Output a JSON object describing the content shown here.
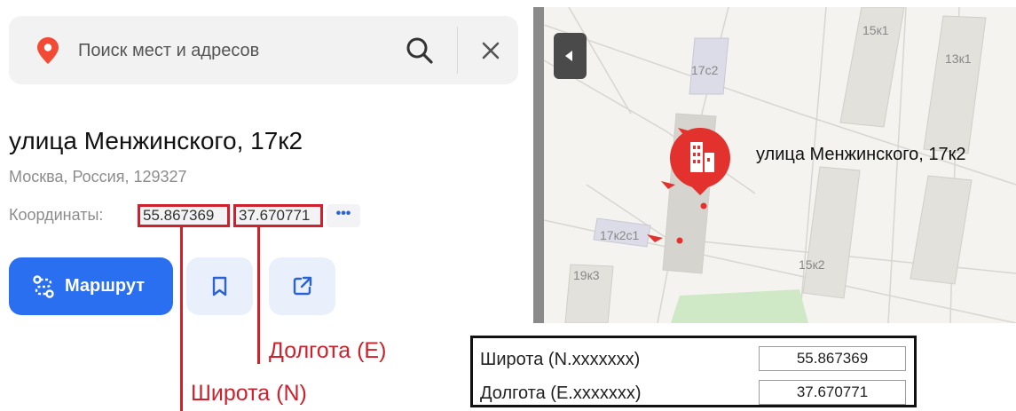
{
  "search": {
    "placeholder": "Поиск мест и адресов",
    "value": ""
  },
  "place": {
    "title": "улица Менжинского, 17к2",
    "address": "Москва, Россия, 129327",
    "coords_label": "Координаты:",
    "latitude": "55.867369",
    "longitude": "37.670771",
    "more_label": "•••"
  },
  "actions": {
    "route_label": "Маршрут"
  },
  "callouts": {
    "longitude": "Долгота (E)",
    "latitude": "Широта (N)"
  },
  "map": {
    "place_label": "улица Менжинского, 17к2",
    "buildings": [
      "17с2",
      "15к1",
      "13к1",
      "17к2с1",
      "19к3",
      "15к2"
    ]
  },
  "form": {
    "latitude_label": "Широта (N.xxxxxxx)",
    "latitude_value": "55.867369",
    "longitude_label": "Долгота (E.xxxxxxx)",
    "longitude_value": "37.670771"
  },
  "colors": {
    "accent_red": "#d0202c",
    "route_blue": "#2a6ff0",
    "pin_red": "#e3312e"
  },
  "icons": [
    "map-pin-icon",
    "search-icon",
    "close-icon",
    "route-icon",
    "bookmark-icon",
    "share-icon",
    "building-icon",
    "collapse-arrow-icon"
  ]
}
